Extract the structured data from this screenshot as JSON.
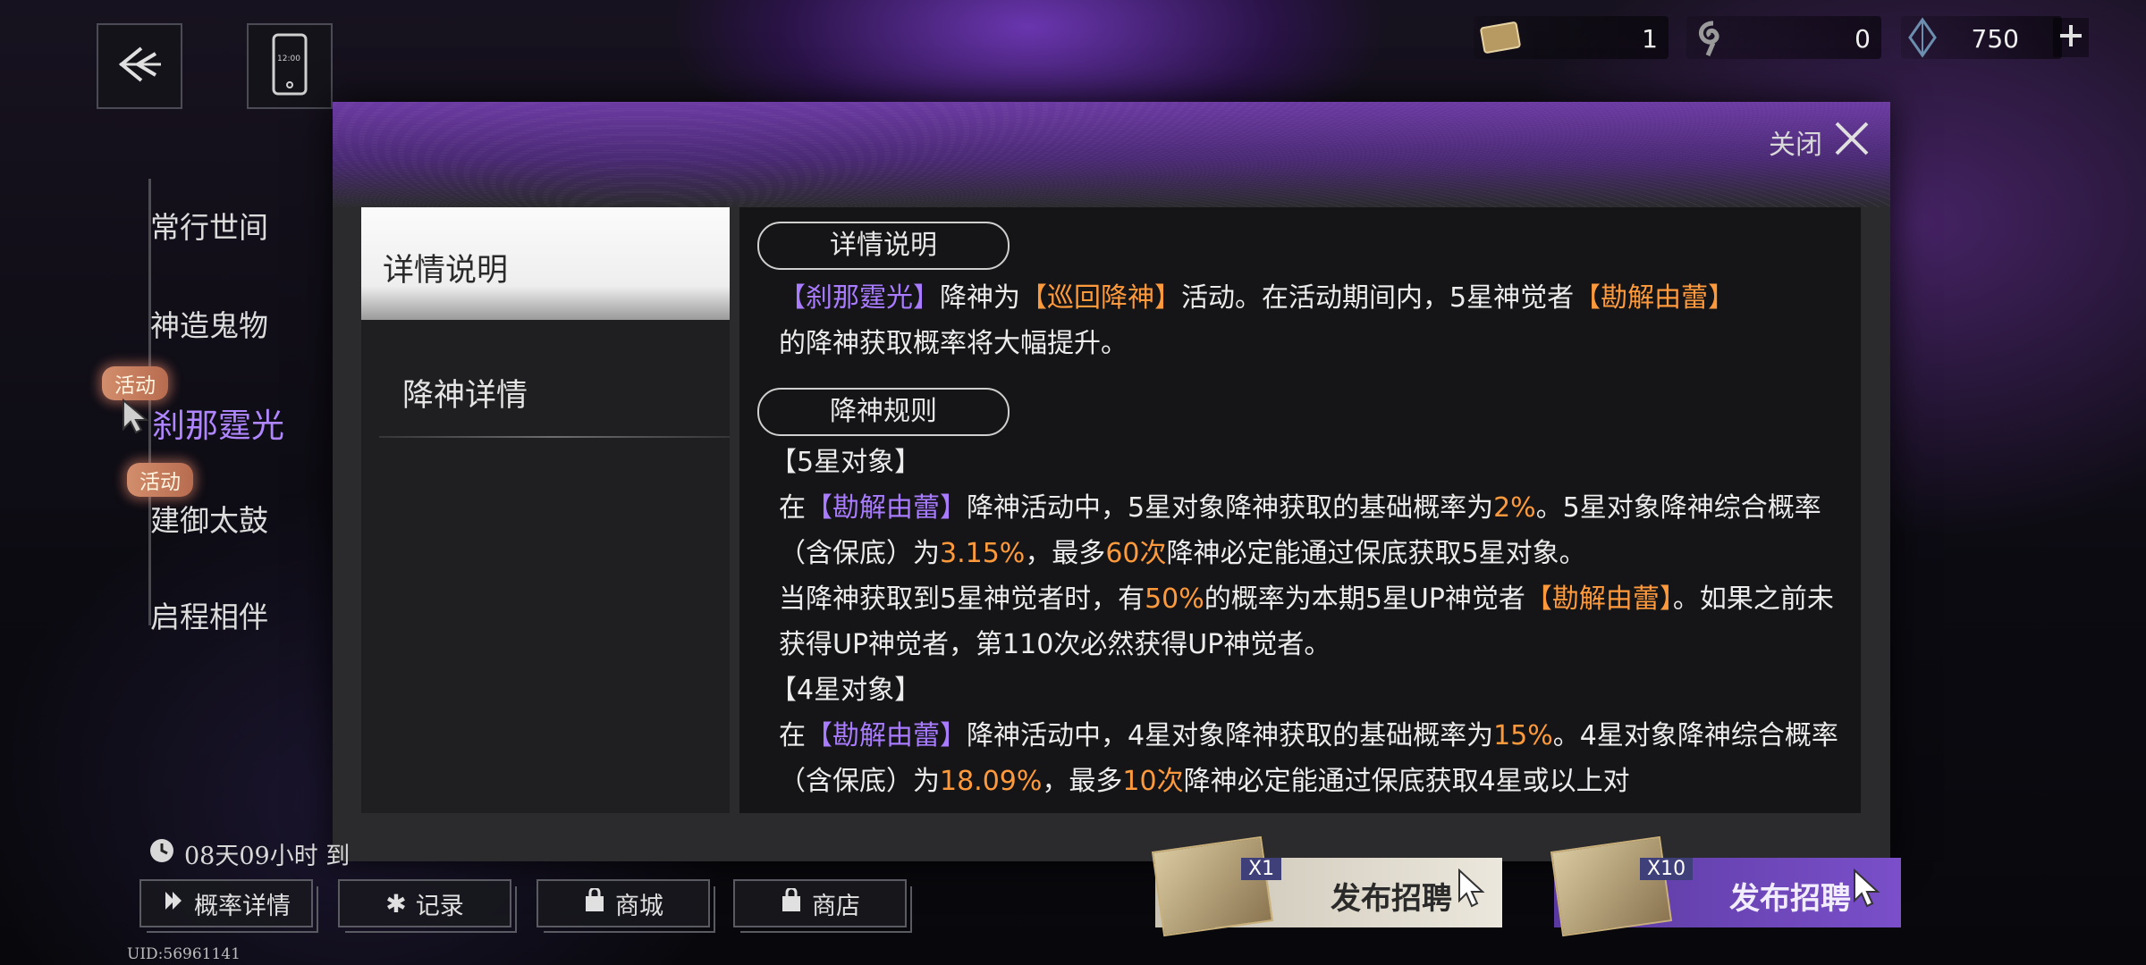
{
  "resources": [
    {
      "icon": "ticket-icon",
      "value": "1"
    },
    {
      "icon": "swirl-icon",
      "value": "0"
    },
    {
      "icon": "crystal-icon",
      "value": "750"
    }
  ],
  "top_buttons": {
    "phone_time": "12:00"
  },
  "nav": {
    "items": [
      {
        "label": "常行世间",
        "badge": ""
      },
      {
        "label": "神造鬼物",
        "badge": ""
      },
      {
        "label": "刹那霆光",
        "badge": "活动"
      },
      {
        "label": "建御太鼓",
        "badge": "活动"
      },
      {
        "label": "启程相伴",
        "badge": ""
      }
    ]
  },
  "modal": {
    "close_label": "关闭",
    "tabs": [
      {
        "label": "详情说明",
        "active": true
      },
      {
        "label": "降神详情",
        "active": false
      }
    ],
    "section1": {
      "title": "详情说明",
      "p1": {
        "a": "【刹那霆光】",
        "b": "降神为",
        "c": "【巡回降神】",
        "d": "活动。在活动期间内，5星神觉者",
        "e": "【勘解由蕾】",
        "f": "的降神获取概率将大幅提升。"
      }
    },
    "section2": {
      "title": "降神规则",
      "star5_heading": "【5星对象】",
      "star5_p1": {
        "a": "在",
        "b": "【勘解由蕾】",
        "c": "降神活动中，5星对象降神获取的基础概率为",
        "d": "2%",
        "e": "。5星对象降神综合概率（含保底）为",
        "f": "3.15%",
        "g": "，最多",
        "h": "60次",
        "i": "降神必定能通过保底获取5星对象。"
      },
      "star5_p2": {
        "a": "当降神获取到5星神觉者时，有",
        "b": "50%",
        "c": "的概率为本期5星UP神觉者",
        "d": "【勘解由蕾】",
        "e": "。如果之前未获得UP神觉者，第110次必然获得UP神觉者。"
      },
      "star4_heading": "【4星对象】",
      "star4_p1": {
        "a": "在",
        "b": "【勘解由蕾】",
        "c": "降神活动中，4星对象降神获取的基础概率为",
        "d": "15%",
        "e": "。4星对象降神综合概率（含保底）为",
        "f": "18.09%",
        "g": "，最多",
        "h": "10次",
        "i": "降神必定能通过保底获取4星或以上对"
      }
    }
  },
  "timer": "08天09小时 到",
  "bottom_buttons": [
    {
      "icon": "arrow-icon",
      "label": "概率详情"
    },
    {
      "icon": "star-icon",
      "label": "记录"
    },
    {
      "icon": "bag-icon",
      "label": "商城"
    },
    {
      "icon": "bag-icon",
      "label": "商店"
    }
  ],
  "recruit": [
    {
      "multiplier": "X1",
      "label": "发布招聘"
    },
    {
      "multiplier": "X10",
      "label": "发布招聘"
    }
  ],
  "uid": "UID:56961141",
  "colors": {
    "purple_highlight": "#a87bff",
    "orange_highlight": "#ff9a3c",
    "header_purple": "#6c3ba3"
  }
}
